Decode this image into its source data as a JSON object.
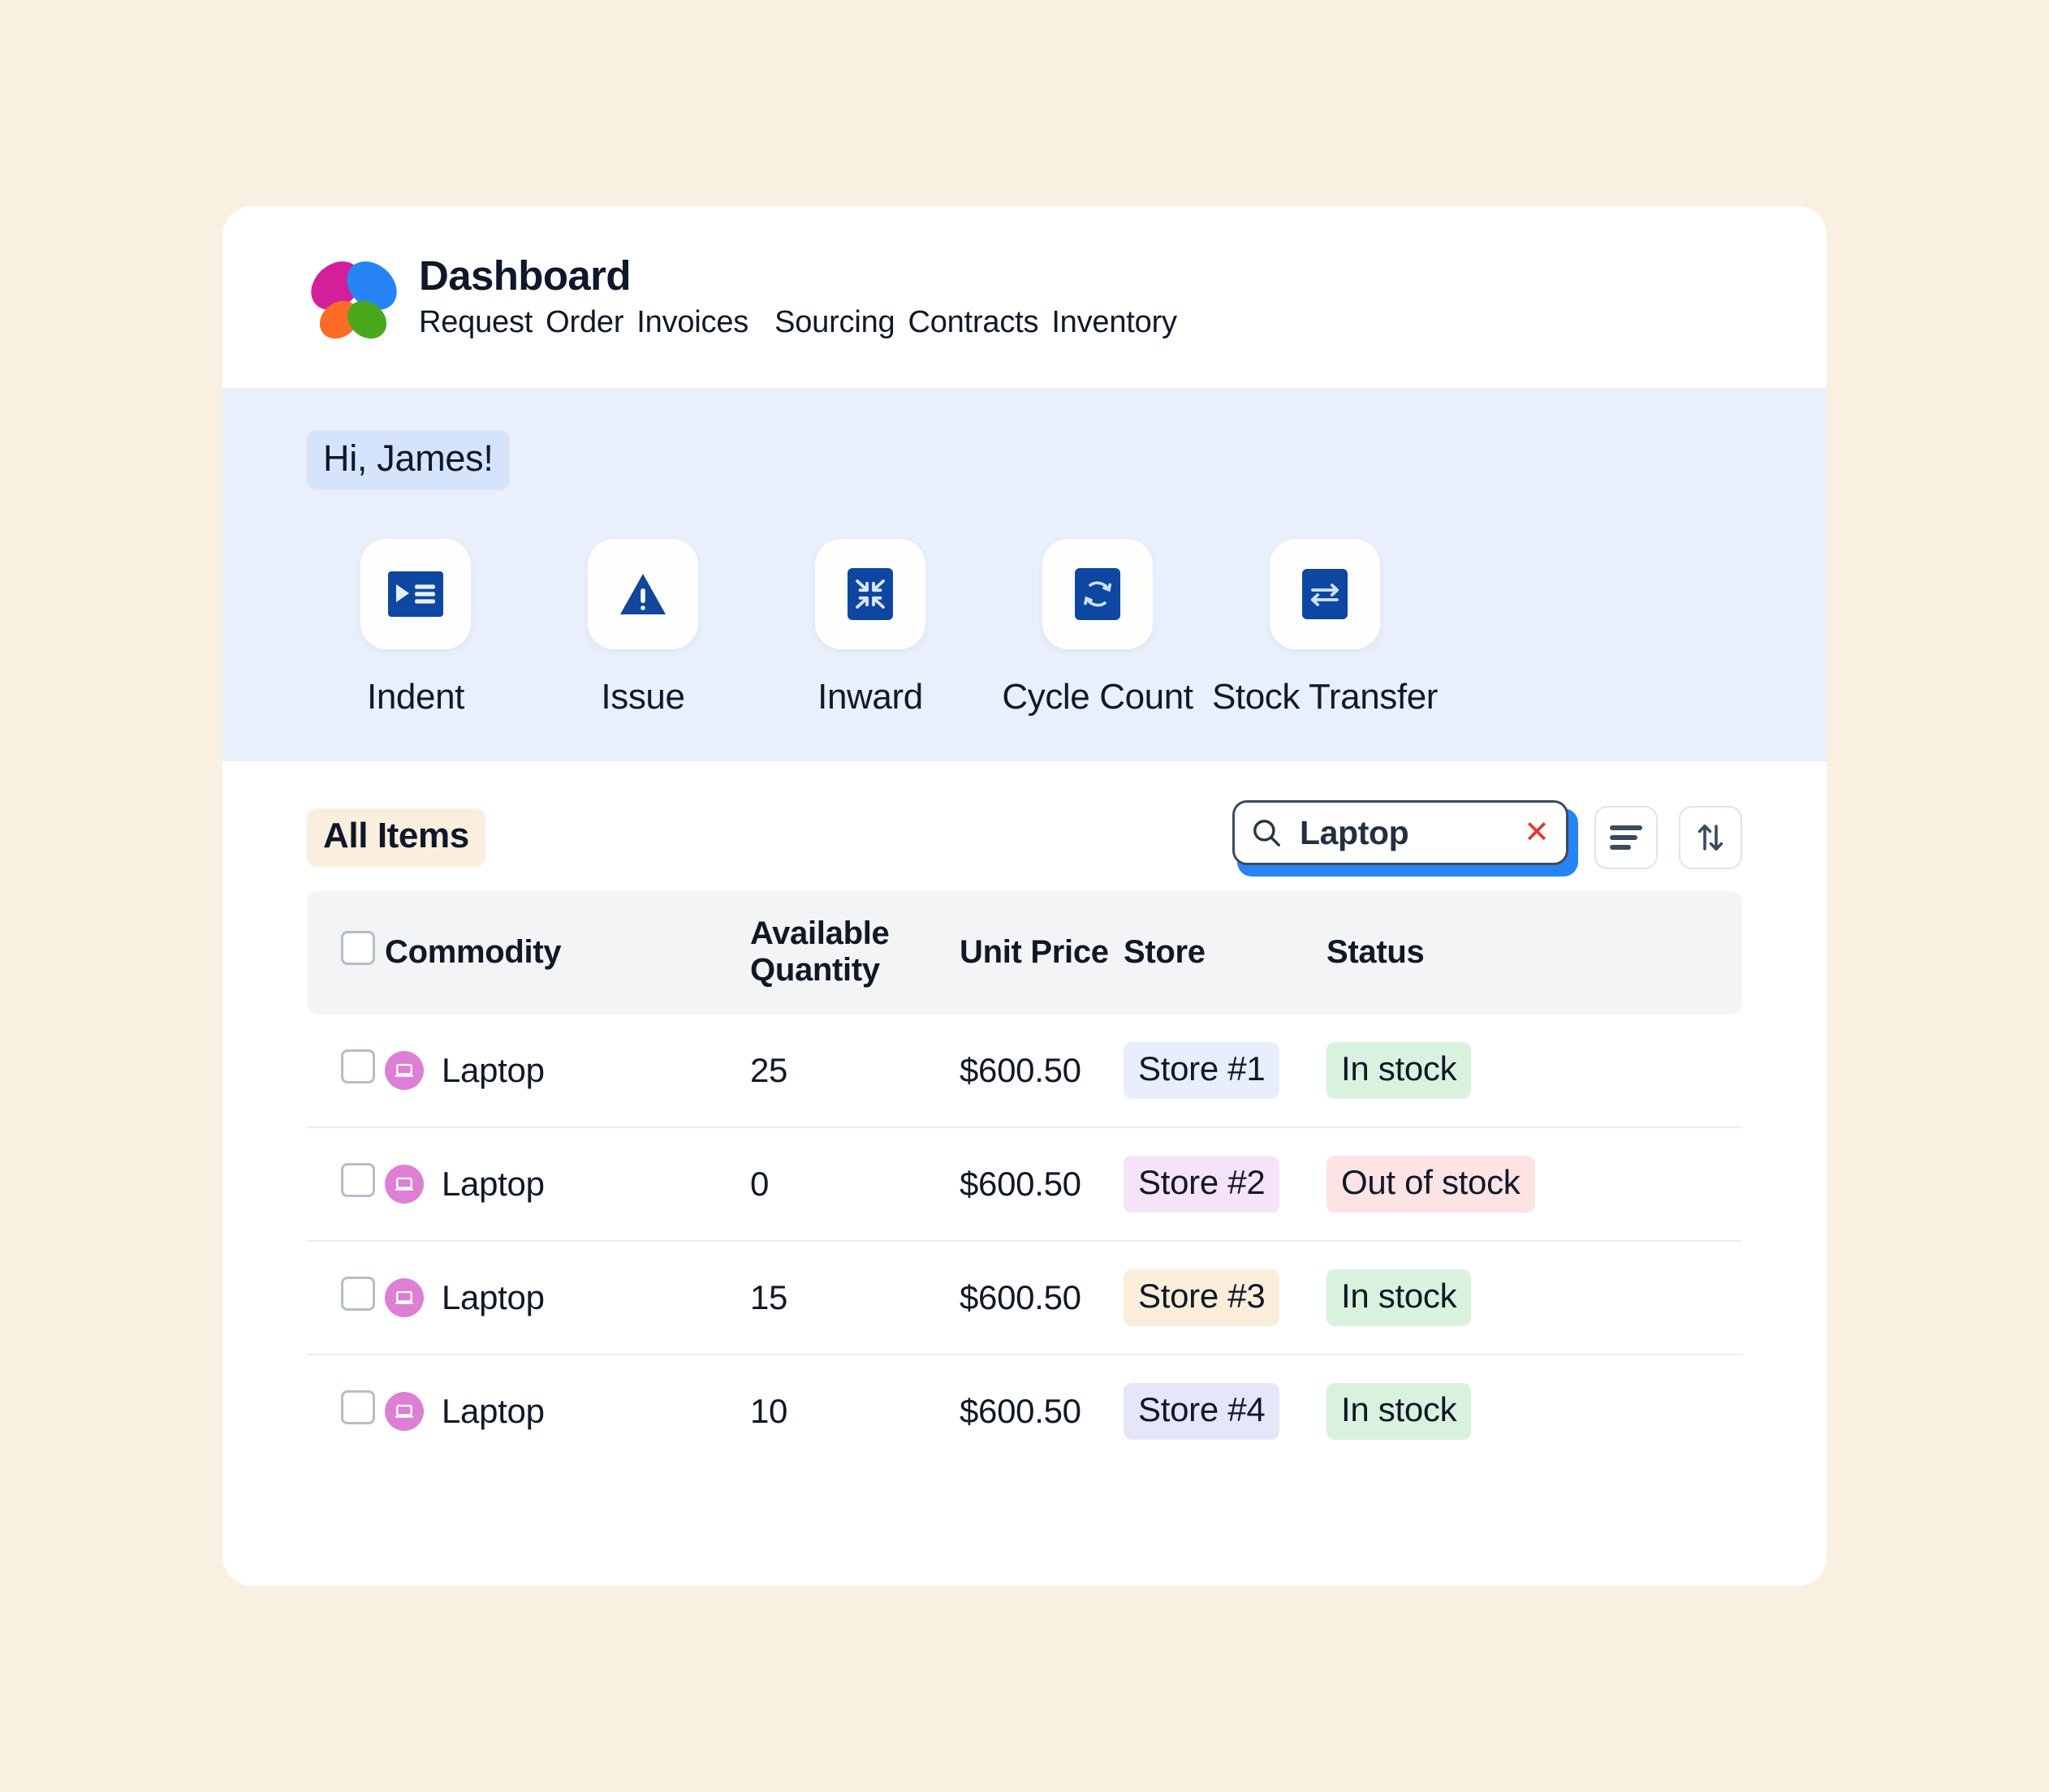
{
  "header": {
    "title": "Dashboard",
    "logo_icon": "flower-logo-icon",
    "nav": [
      {
        "label": "Request"
      },
      {
        "label": "Order"
      },
      {
        "label": "Invoices"
      },
      {
        "label": "Sourcing"
      },
      {
        "label": "Contracts"
      },
      {
        "label": "Inventory"
      }
    ]
  },
  "quick_actions": {
    "greeting": "Hi, James!",
    "items": [
      {
        "label": "Indent",
        "icon": "playlist-icon"
      },
      {
        "label": "Issue",
        "icon": "warning-triangle-icon"
      },
      {
        "label": "Inward",
        "icon": "arrows-collapse-icon"
      },
      {
        "label": "Cycle Count",
        "icon": "refresh-cycle-icon"
      },
      {
        "label": "Stock Transfer",
        "icon": "transfer-arrows-icon"
      }
    ]
  },
  "toolbar": {
    "all_items_label": "All Items",
    "search": {
      "value": "Laptop",
      "placeholder": "Search",
      "icon": "search-icon",
      "clear_icon": "close-x-icon",
      "clear_symbol": "✕"
    },
    "filter_button": {
      "icon": "filter-lines-icon",
      "label": "Filter"
    },
    "sort_button": {
      "icon": "sort-arrows-icon",
      "label": "Sort"
    }
  },
  "table": {
    "select_all_checkbox": false,
    "columns": [
      "Commodity",
      "Available Quantity",
      "Unit Price",
      "Store",
      "Status"
    ],
    "rows": [
      {
        "checked": false,
        "avatar_icon": "laptop-icon",
        "commodity": "Laptop",
        "quantity": "25",
        "unit_price": "$600.50",
        "store": "Store #1",
        "store_color": "#e8eefc",
        "status": "In stock",
        "status_color": "#d9f2dd"
      },
      {
        "checked": false,
        "avatar_icon": "laptop-icon",
        "commodity": "Laptop",
        "quantity": "0",
        "unit_price": "$600.50",
        "store": "Store #2",
        "store_color": "#f5e4f7",
        "status": "Out of stock",
        "status_color": "#fde3e3"
      },
      {
        "checked": false,
        "avatar_icon": "laptop-icon",
        "commodity": "Laptop",
        "quantity": "15",
        "unit_price": "$600.50",
        "store": "Store #3",
        "store_color": "#faeedb",
        "status": "In stock",
        "status_color": "#d9f2dd"
      },
      {
        "checked": false,
        "avatar_icon": "laptop-icon",
        "commodity": "Laptop",
        "quantity": "10",
        "unit_price": "$600.50",
        "store": "Store #4",
        "store_color": "#e6e6f9",
        "status": "In stock",
        "status_color": "#d9f2dd"
      }
    ]
  },
  "colors": {
    "page_background": "#faf0e1",
    "card_background": "#ffffff",
    "actions_band": "#e9f0fc",
    "greeting_highlight": "#d6e4fb",
    "all_items_highlight": "#faefdf",
    "accent_blue": "#0d47a1",
    "focus_blue": "#2684f5",
    "avatar_pink": "#dd7fd4",
    "clear_red": "#e0392b",
    "logo_magenta": "#d41f9b",
    "logo_blue": "#2684f5",
    "logo_orange": "#fc6c26",
    "logo_green": "#4ba81c"
  }
}
